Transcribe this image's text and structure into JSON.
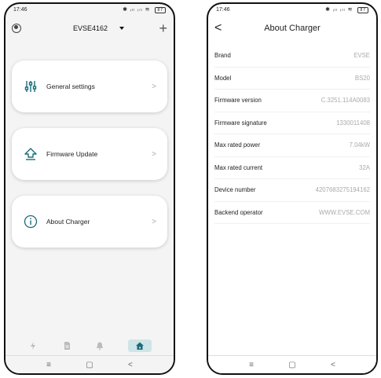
{
  "phone1": {
    "status": {
      "time": "17:46",
      "indicators": "✱ ᵢₗₗ ᵢₗₗ ≋",
      "battery": "87"
    },
    "header": {
      "device": "EVSE4162",
      "add": "+"
    },
    "cards": [
      {
        "label": "General settings",
        "icon": "sliders-icon"
      },
      {
        "label": "Firmware Update",
        "icon": "upload-arrow-icon"
      },
      {
        "label": "About Charger",
        "icon": "info-icon"
      }
    ],
    "chevron": ">",
    "nav": [
      "charge-icon",
      "document-icon",
      "bell-icon",
      "home-icon"
    ],
    "sysnav": {
      "menu": "≡",
      "home": "▢",
      "back": "<"
    }
  },
  "phone2": {
    "status": {
      "time": "17:46",
      "indicators": "✱ ᵢₗₗ ᵢₗₗ ≋",
      "battery": "87"
    },
    "header": {
      "title": "About Charger",
      "back": "<"
    },
    "rows": [
      {
        "key": "Brand",
        "value": "EVSE"
      },
      {
        "key": "Model",
        "value": "BS20"
      },
      {
        "key": "Firmware version",
        "value": "C.3251.114A0083"
      },
      {
        "key": "Firmware signature",
        "value": "1330011408"
      },
      {
        "key": "Max rated power",
        "value": "7.04kW"
      },
      {
        "key": "Max rated current",
        "value": "32A"
      },
      {
        "key": "Device number",
        "value": "4207683275194162"
      },
      {
        "key": "Backend operator",
        "value": "WWW.EVSE.COM"
      }
    ],
    "sysnav": {
      "menu": "≡",
      "home": "▢",
      "back": "<"
    }
  },
  "colors": {
    "accent": "#1a6b7a",
    "active_nav_bg": "#cfe4e6"
  }
}
